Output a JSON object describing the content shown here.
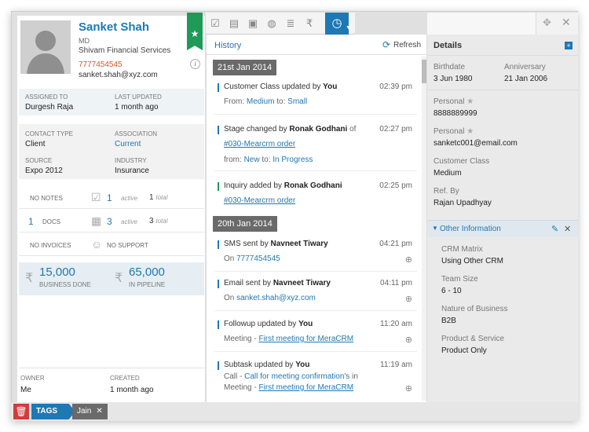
{
  "contact": {
    "name": "Sanket Shah",
    "title": "MD",
    "company": "Shivam Financial Services",
    "phone": "7777454545",
    "email": "sanket.shah@xyz.com"
  },
  "assignment": {
    "assigned_label": "ASSIGNED TO",
    "assigned_value": "Durgesh Raja",
    "updated_label": "LAST UPDATED",
    "updated_value": "1 month ago"
  },
  "classification": {
    "contact_type_label": "CONTACT TYPE",
    "contact_type_value": "Client",
    "association_label": "ASSOCIATION",
    "association_value": "Current",
    "source_label": "SOURCE",
    "source_value": "Expo 2012",
    "industry_label": "INDUSTRY",
    "industry_value": "Insurance"
  },
  "stats": {
    "notes": {
      "label": "NO NOTES",
      "active": "1",
      "active_label": "active",
      "total": "1",
      "total_label": "total"
    },
    "docs": {
      "count": "1",
      "label": "DOCS",
      "active": "3",
      "active_label": "active",
      "total": "3",
      "total_label": "total"
    },
    "invoices_label": "NO INVOICES",
    "support_label": "NO SUPPORT"
  },
  "money": {
    "done_value": "15,000",
    "done_label": "BUSINESS DONE",
    "pipeline_value": "65,000",
    "pipeline_label": "IN PIPELINE"
  },
  "owner": {
    "owner_label": "OWNER",
    "owner_value": "Me",
    "created_label": "CREATED",
    "created_value": "1 month ago"
  },
  "history": {
    "title": "History",
    "refresh_label": "Refresh",
    "groups": [
      {
        "date": "21st Jan 2014",
        "entries": [
          {
            "pre": "Customer Class updated by ",
            "who": "You",
            "time": "02:39 pm",
            "line2_pre": "From: ",
            "line2_a": "Medium",
            "line2_mid": " to: ",
            "line2_b": "Small"
          },
          {
            "pre": "Stage changed by ",
            "who": "Ronak Godhani",
            "post": " of",
            "time": "02:27 pm",
            "line2_link": "#030-Mearcrm order",
            "line3_pre": "from: ",
            "line3_a": "New",
            "line3_mid": " to: ",
            "line3_b": "In Progress"
          },
          {
            "pre": "Inquiry added by ",
            "who": "Ronak Godhani",
            "time": "02:25 pm",
            "line2_link": "#030-Mearcrm order"
          }
        ]
      },
      {
        "date": "20th Jan 2014",
        "entries": [
          {
            "pre": "SMS sent by ",
            "who": "Navneet Tiwary",
            "time": "04:21 pm",
            "line2_pre": "On ",
            "line2_a": "7777454545"
          },
          {
            "pre": "Email sent by ",
            "who": "Navneet Tiwary",
            "time": "04:11 pm",
            "line2_pre": "On ",
            "line2_a": "sanket.shah@xyz.com"
          },
          {
            "pre": "Followup updated by ",
            "who": "You",
            "time": "11:20 am",
            "line2_pre": "Meeting - ",
            "line2_link": "First meeting for MeraCRM"
          },
          {
            "pre": "Subtask updated by ",
            "who": "You",
            "time": "11:19 am",
            "line2_pre": "Call - ",
            "line2_a": "Call for meeting confirmation's",
            "line2_post": " in",
            "line3_pre": "Meeting - ",
            "line3_link": "First meeting for MeraCRM"
          }
        ]
      }
    ]
  },
  "details": {
    "title": "Details",
    "birthdate_label": "Birthdate",
    "birthdate_value": "3 Jun 1980",
    "anniversary_label": "Anniversary",
    "anniversary_value": "21 Jan 2006",
    "personal_phone_label": "Personal",
    "personal_phone_value": "8888889999",
    "personal_email_label": "Personal",
    "personal_email_value": "sanketc001@email.com",
    "customer_class_label": "Customer Class",
    "customer_class_value": "Medium",
    "ref_label": "Ref. By",
    "ref_value": "Rajan Upadhyay",
    "other_title": "Other Information",
    "other": [
      {
        "label": "CRM Matrix",
        "value": "Using Other CRM"
      },
      {
        "label": "Team Size",
        "value": "6 - 10"
      },
      {
        "label": "Nature of Business",
        "value": "B2B"
      },
      {
        "label": "Product & Service",
        "value": "Product Only"
      }
    ]
  },
  "tags": {
    "button_label": "TAGS",
    "items": [
      {
        "label": "Jain"
      }
    ]
  },
  "colors": {
    "accent": "#1e78b4",
    "favorite": "#1f9a57",
    "danger": "#d33c3c",
    "phone": "#d4582a"
  }
}
